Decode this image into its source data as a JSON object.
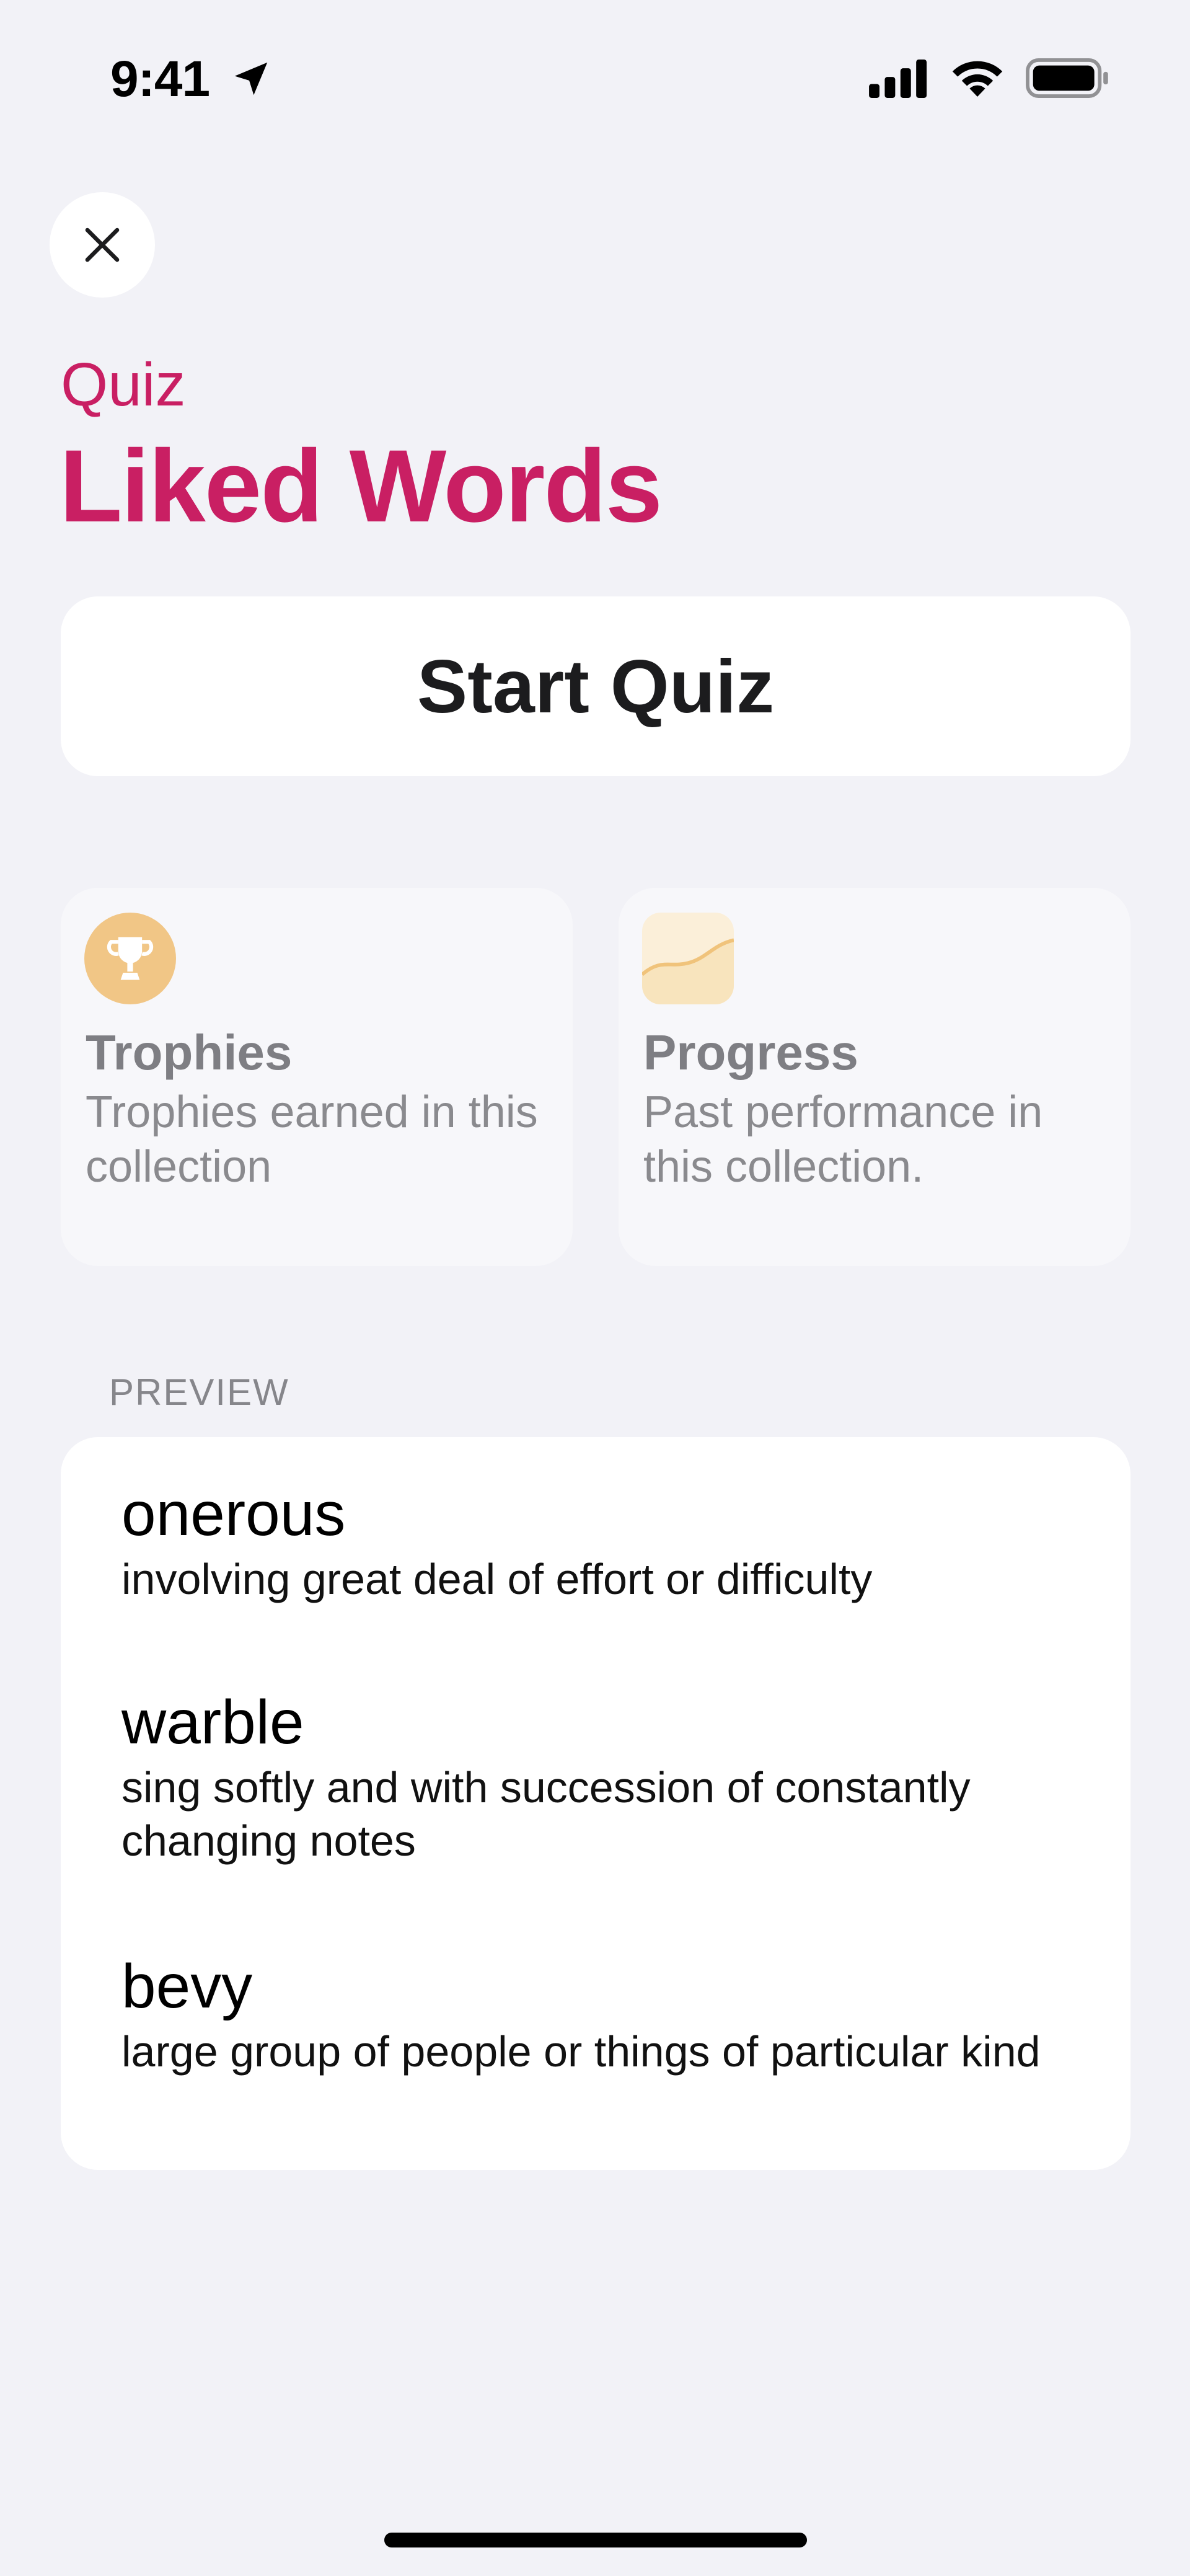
{
  "status_bar": {
    "time": "9:41",
    "icons": [
      "location-arrow-icon",
      "signal-icon",
      "wifi-icon",
      "battery-icon"
    ]
  },
  "header": {
    "close_icon": "close-icon",
    "eyebrow": "Quiz",
    "title": "Liked Words"
  },
  "actions": {
    "start_label": "Start Quiz"
  },
  "cards": [
    {
      "icon": "trophy-icon",
      "title": "Trophies",
      "description": "Trophies earned in this collection"
    },
    {
      "icon": "progress-chart-icon",
      "title": "Progress",
      "description": "Past performance in this collection."
    }
  ],
  "preview": {
    "header": "PREVIEW",
    "words": [
      {
        "term": "onerous",
        "definition": "involving great deal of effort or difficulty"
      },
      {
        "term": "warble",
        "definition": "sing softly and with succession of constantly changing notes"
      },
      {
        "term": "bevy",
        "definition": "large group of people or things of particular kind"
      }
    ]
  },
  "colors": {
    "accent": "#c91f63",
    "background": "#f2f2f7",
    "card": "#ffffff",
    "trophy_badge": "#f1c686",
    "progress_badge": "#fbefd9"
  }
}
